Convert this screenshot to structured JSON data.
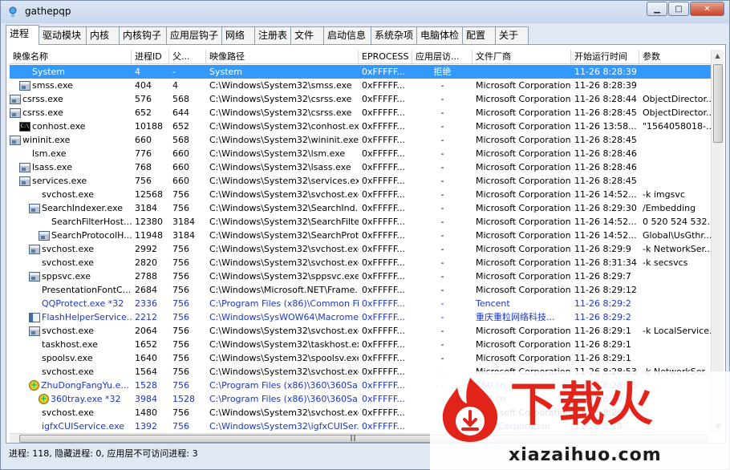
{
  "window": {
    "title": "gathepqp"
  },
  "tabs": [
    "进程",
    "驱动模块",
    "内核",
    "内核钩子",
    "应用层钩子",
    "网络",
    "注册表",
    "文件",
    "启动信息",
    "系统杂项",
    "电脑体检",
    "配置",
    "关于"
  ],
  "columns": [
    "映像名称",
    "进程ID",
    "父...",
    "映像路径",
    "EPROCESS",
    "应用层访...",
    "文件厂商",
    "开始运行时间",
    "参数"
  ],
  "rows": [
    {
      "icon": "blank",
      "indent": 1,
      "name": "System",
      "pid": "4",
      "ppid": "-",
      "path": "System",
      "eprocess": "0xFFFFF...",
      "access": "拒绝",
      "vendor": "",
      "start": "11-26 8:28:39",
      "args": "",
      "selected": true
    },
    {
      "icon": "window",
      "indent": 1,
      "name": "smss.exe",
      "pid": "404",
      "ppid": "4",
      "path": "C:\\Windows\\System32\\smss.exe",
      "eprocess": "0xFFFFF...",
      "access": "-",
      "vendor": "Microsoft Corporation",
      "start": "11-26 8:28:39",
      "args": ""
    },
    {
      "icon": "window",
      "indent": 0,
      "name": "csrss.exe",
      "pid": "576",
      "ppid": "568",
      "path": "C:\\Windows\\System32\\csrss.exe",
      "eprocess": "0xFFFFF...",
      "access": "-",
      "vendor": "Microsoft Corporation",
      "start": "11-26 8:28:44",
      "args": "ObjectDirector..."
    },
    {
      "icon": "window",
      "indent": 0,
      "name": "csrss.exe",
      "pid": "652",
      "ppid": "644",
      "path": "C:\\Windows\\System32\\csrss.exe",
      "eprocess": "0xFFFFF...",
      "access": "-",
      "vendor": "Microsoft Corporation",
      "start": "11-26 8:28:45",
      "args": "ObjectDirector..."
    },
    {
      "icon": "cmd",
      "indent": 1,
      "name": "conhost.exe",
      "pid": "10188",
      "ppid": "652",
      "path": "C:\\Windows\\System32\\conhost.exe",
      "eprocess": "0xFFFFF...",
      "access": "-",
      "vendor": "Microsoft Corporation",
      "start": "11-26 13:58...",
      "args": "\"1564058018-..."
    },
    {
      "icon": "window",
      "indent": 0,
      "name": "wininit.exe",
      "pid": "660",
      "ppid": "568",
      "path": "C:\\Windows\\System32\\wininit.exe",
      "eprocess": "0xFFFFF...",
      "access": "-",
      "vendor": "Microsoft Corporation",
      "start": "11-26 8:28:45",
      "args": ""
    },
    {
      "icon": "blank",
      "indent": 1,
      "name": "lsm.exe",
      "pid": "776",
      "ppid": "660",
      "path": "C:\\Windows\\System32\\lsm.exe",
      "eprocess": "0xFFFFF...",
      "access": "-",
      "vendor": "Microsoft Corporation",
      "start": "11-26 8:28:46",
      "args": ""
    },
    {
      "icon": "window",
      "indent": 1,
      "name": "lsass.exe",
      "pid": "768",
      "ppid": "660",
      "path": "C:\\Windows\\System32\\lsass.exe",
      "eprocess": "0xFFFFF...",
      "access": "-",
      "vendor": "Microsoft Corporation",
      "start": "11-26 8:28:46",
      "args": ""
    },
    {
      "icon": "window",
      "indent": 1,
      "name": "services.exe",
      "pid": "756",
      "ppid": "660",
      "path": "C:\\Windows\\System32\\services.exe",
      "eprocess": "0xFFFFF...",
      "access": "-",
      "vendor": "Microsoft Corporation",
      "start": "11-26 8:28:45",
      "args": ""
    },
    {
      "icon": "blank",
      "indent": 2,
      "name": "svchost.exe",
      "pid": "12568",
      "ppid": "756",
      "path": "C:\\Windows\\System32\\svchost.exe",
      "eprocess": "0xFFFFF...",
      "access": "-",
      "vendor": "Microsoft Corporation",
      "start": "11-26 14:52...",
      "args": "-k imgsvc"
    },
    {
      "icon": "window",
      "indent": 2,
      "name": "SearchIndexer.exe",
      "pid": "3184",
      "ppid": "756",
      "path": "C:\\Windows\\System32\\SearchInd...",
      "eprocess": "0xFFFFF...",
      "access": "-",
      "vendor": "Microsoft Corporation",
      "start": "11-26 8:29:30",
      "args": "/Embedding"
    },
    {
      "icon": "blank",
      "indent": 3,
      "name": "SearchFilterHost...",
      "pid": "12380",
      "ppid": "3184",
      "path": "C:\\Windows\\System32\\SearchFilte...",
      "eprocess": "0xFFFFF...",
      "access": "-",
      "vendor": "Microsoft Corporation",
      "start": "11-26 14:52...",
      "args": "0 520 524 532..."
    },
    {
      "icon": "window",
      "indent": 3,
      "name": "SearchProtocolH...",
      "pid": "11948",
      "ppid": "3184",
      "path": "C:\\Windows\\System32\\SearchProt...",
      "eprocess": "0xFFFFF...",
      "access": "-",
      "vendor": "Microsoft Corporation",
      "start": "11-26 14:52...",
      "args": "Global\\UsGthr..."
    },
    {
      "icon": "window",
      "indent": 2,
      "name": "svchost.exe",
      "pid": "2992",
      "ppid": "756",
      "path": "C:\\Windows\\System32\\svchost.exe",
      "eprocess": "0xFFFFF...",
      "access": "-",
      "vendor": "Microsoft Corporation",
      "start": "11-26 8:29:9",
      "args": "-k NetworkSer..."
    },
    {
      "icon": "blank",
      "indent": 2,
      "name": "svchost.exe",
      "pid": "2820",
      "ppid": "756",
      "path": "C:\\Windows\\System32\\svchost.exe",
      "eprocess": "0xFFFFF...",
      "access": "-",
      "vendor": "Microsoft Corporation",
      "start": "11-26 8:31:34",
      "args": "-k secsvcs"
    },
    {
      "icon": "window",
      "indent": 2,
      "name": "sppsvc.exe",
      "pid": "2788",
      "ppid": "756",
      "path": "C:\\Windows\\System32\\sppsvc.exe",
      "eprocess": "0xFFFFF...",
      "access": "-",
      "vendor": "Microsoft Corporation",
      "start": "11-26 8:29:7",
      "args": ""
    },
    {
      "icon": "blank",
      "indent": 2,
      "name": "PresentationFontC...",
      "pid": "2684",
      "ppid": "756",
      "path": "C:\\Windows\\Microsoft.NET\\Frame...",
      "eprocess": "0xFFFFF...",
      "access": "-",
      "vendor": "Microsoft Corporation",
      "start": "11-26 8:29:12",
      "args": ""
    },
    {
      "icon": "blank",
      "indent": 2,
      "name": "QQProtect.exe *32",
      "pid": "2336",
      "ppid": "756",
      "path": "C:\\Program Files (x86)\\Common Fil...",
      "eprocess": "0xFFFFF...",
      "access": "-",
      "vendor": "Tencent",
      "start": "11-26 8:29:2",
      "args": "",
      "blue": true
    },
    {
      "icon": "box",
      "indent": 2,
      "name": "FlashHelperService...",
      "pid": "2212",
      "ppid": "756",
      "path": "C:\\Windows\\SysWOW64\\Macrome...",
      "eprocess": "0xFFFFF...",
      "access": "-",
      "vendor": "重庆重粒网络科技...",
      "start": "11-26 8:29:2",
      "args": "",
      "blue": true
    },
    {
      "icon": "window",
      "indent": 2,
      "name": "svchost.exe",
      "pid": "2064",
      "ppid": "756",
      "path": "C:\\Windows\\System32\\svchost.exe",
      "eprocess": "0xFFFFF...",
      "access": "-",
      "vendor": "Microsoft Corporation",
      "start": "11-26 8:29:1",
      "args": "-k LocalService..."
    },
    {
      "icon": "blank",
      "indent": 2,
      "name": "taskhost.exe",
      "pid": "1652",
      "ppid": "756",
      "path": "C:\\Windows\\System32\\taskhost.exe",
      "eprocess": "0xFFFFF...",
      "access": "-",
      "vendor": "Microsoft Corporation",
      "start": "11-26 8:29:1",
      "args": ""
    },
    {
      "icon": "blank",
      "indent": 2,
      "name": "spoolsv.exe",
      "pid": "1640",
      "ppid": "756",
      "path": "C:\\Windows\\System32\\spoolsv.exe",
      "eprocess": "0xFFFFF...",
      "access": "-",
      "vendor": "Microsoft Corporation",
      "start": "11-26 8:29:1",
      "args": ""
    },
    {
      "icon": "blank",
      "indent": 2,
      "name": "svchost.exe",
      "pid": "1564",
      "ppid": "756",
      "path": "C:\\Windows\\System32\\svchost.exe",
      "eprocess": "0xFFFFF...",
      "access": "-",
      "vendor": "Microsoft Corporation",
      "start": "11-26 8:28:53",
      "args": "-k NetworkSer...",
      "plus": true
    },
    {
      "icon": "360",
      "indent": 2,
      "name": "ZhuDongFangYu.e...",
      "pid": "1528",
      "ppid": "756",
      "path": "C:\\Program Files (x86)\\360\\360Sa...",
      "eprocess": "0xFFFFF...",
      "access": "-",
      "vendor": "360.cn",
      "start": "11-26 8:28:53",
      "args": "",
      "blue": true
    },
    {
      "icon": "360",
      "indent": 3,
      "name": "360tray.exe *32",
      "pid": "3984",
      "ppid": "1528",
      "path": "C:\\Program Files (x86)\\360\\360Sa...",
      "eprocess": "0xFFFFF...",
      "access": "-",
      "vendor": "360.cn",
      "start": "11-26 8:29:...",
      "args": "",
      "blue": true
    },
    {
      "icon": "blank",
      "indent": 2,
      "name": "svchost.exe",
      "pid": "1480",
      "ppid": "756",
      "path": "C:\\Windows\\System32\\svchost.exe",
      "eprocess": "0xFFFFF...",
      "access": "-",
      "vendor": "Microsoft Corporation",
      "start": "11-26 8:28:...",
      "args": ""
    },
    {
      "icon": "blank",
      "indent": 2,
      "name": "igfxCUIService.exe",
      "pid": "1392",
      "ppid": "756",
      "path": "C:\\Windows\\System32\\igfxCUISer...",
      "eprocess": "0xFFFFF...",
      "access": "-",
      "vendor": "Intel Corporation",
      "start": "11-26 8:28:...",
      "args": "",
      "blue": true
    }
  ],
  "status": {
    "text": "进程: 118, 隐藏进程: 0, 应用层不可访问进程: 3"
  },
  "watermark": {
    "brand": "下载火",
    "url": "xiazaihuo.com"
  }
}
